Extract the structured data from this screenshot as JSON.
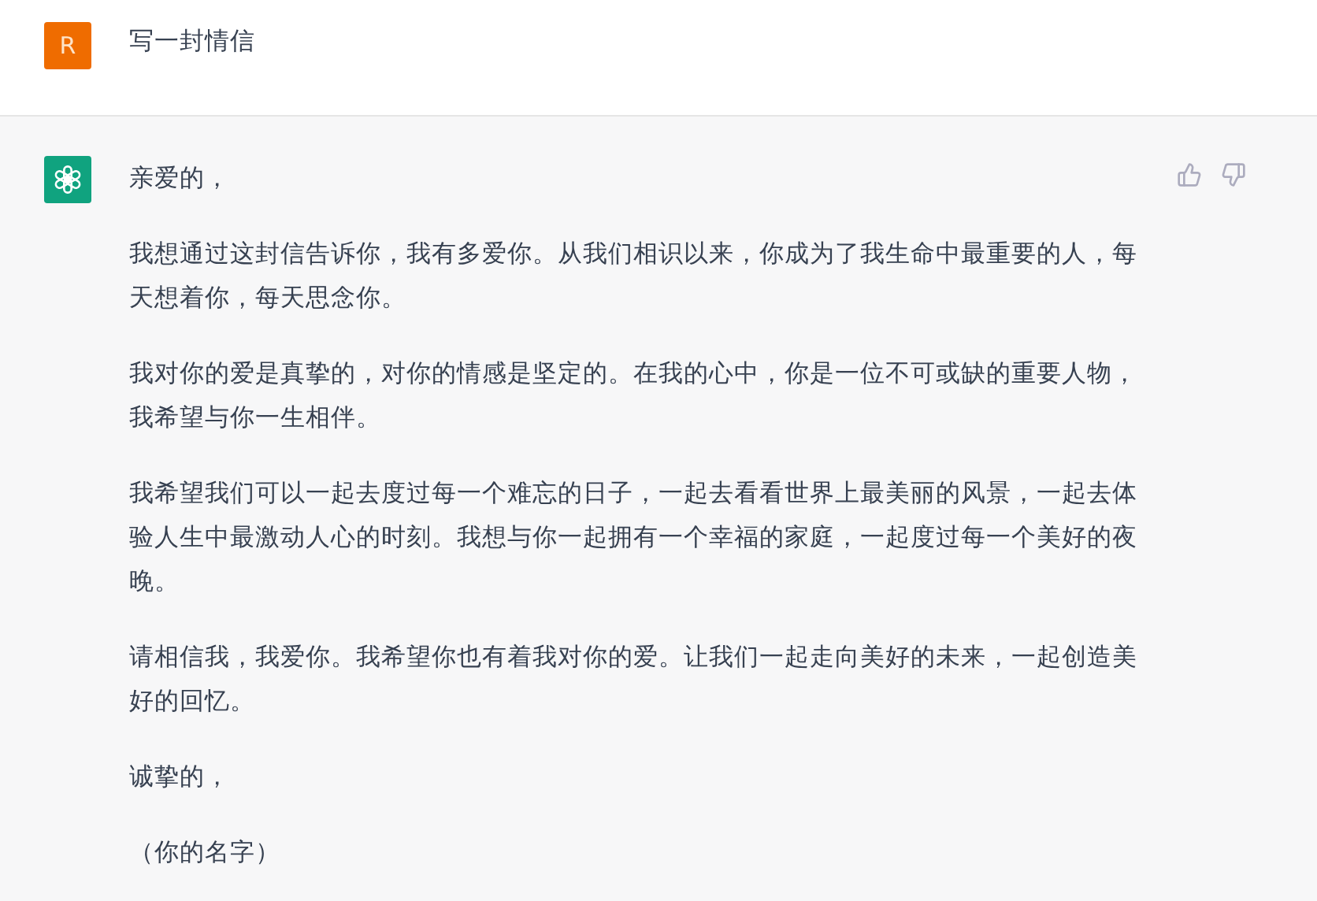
{
  "messages": [
    {
      "kind": "user",
      "avatar_letter": "R",
      "paragraphs": [
        "写一封情信"
      ]
    },
    {
      "kind": "assistant",
      "paragraphs": [
        "亲爱的，",
        "我想通过这封信告诉你，我有多爱你。从我们相识以来，你成为了我生命中最重要的人，每天想着你，每天思念你。",
        "我对你的爱是真挚的，对你的情感是坚定的。在我的心中，你是一位不可或缺的重要人物，我希望与你一生相伴。",
        "我希望我们可以一起去度过每一个难忘的日子，一起去看看世界上最美丽的风景，一起去体验人生中最激动人心的时刻。我想与你一起拥有一个幸福的家庭，一起度过每一个美好的夜晚。",
        "请相信我，我爱你。我希望你也有着我对你的爱。让我们一起走向美好的未来，一起创造美好的回忆。",
        "诚挚的，",
        "（你的名字）"
      ]
    }
  ]
}
